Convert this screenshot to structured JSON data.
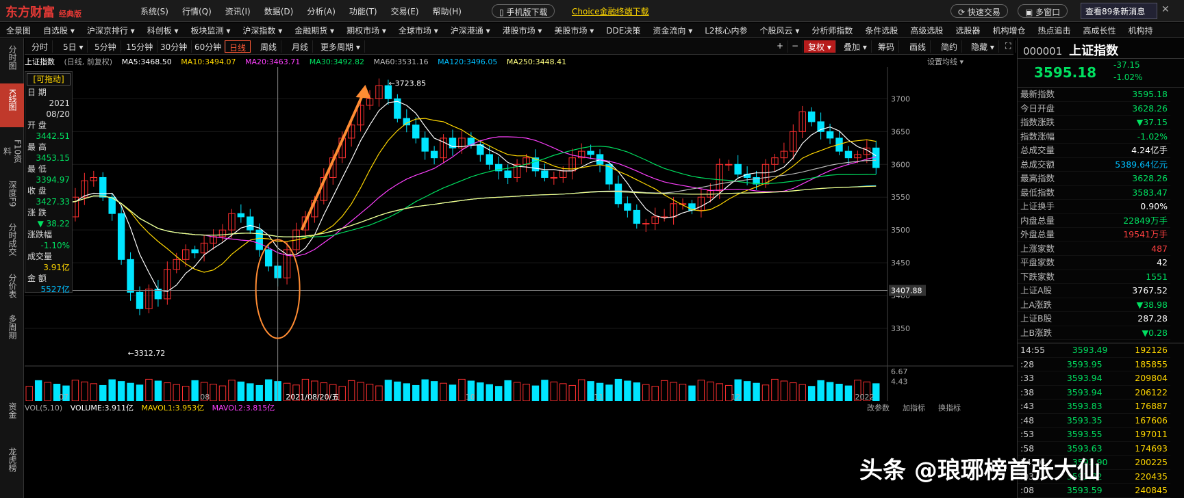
{
  "app": {
    "logo": "东方财富",
    "edition": "经典版"
  },
  "menu": [
    "系统(S)",
    "行情(Q)",
    "资讯(I)",
    "数据(D)",
    "分析(A)",
    "功能(T)",
    "交易(E)",
    "帮助(H)"
  ],
  "title_buttons": {
    "mobile": "手机版下载",
    "choice": "Choice金融终端下载",
    "quick_trade": "快速交易",
    "multi_window": "多窗口",
    "notice": "查看89条新消息"
  },
  "nav": [
    "全景图",
    "自选股 ▾",
    "沪深京排行 ▾",
    "科创板 ▾",
    "板块监测 ▾",
    "沪深指数 ▾",
    "金融期货 ▾",
    "期权市场 ▾",
    "全球市场 ▾",
    "沪深港通 ▾",
    "港股市场 ▾",
    "美股市场 ▾",
    "DDE决策",
    "资金流向 ▾",
    "L2核心内参",
    "个股风云 ▾",
    "分析师指数",
    "条件选股",
    "高级选股",
    "选股器",
    "机构增仓",
    "热点追击",
    "高成长性",
    "机构持"
  ],
  "leftside": [
    "分时图",
    "K线图",
    "F10资料",
    "深度F9",
    "分时成交",
    "分价表",
    "多周期",
    "资金",
    "龙虎榜"
  ],
  "periods": [
    "分时",
    "5日 ▾",
    "5分钟",
    "15分钟",
    "30分钟",
    "60分钟",
    "日线",
    "周线",
    "月线",
    "更多周期 ▾"
  ],
  "tools": [
    "+",
    "−",
    "复权 ▾",
    "叠加 ▾",
    "筹码",
    "画线",
    "简约",
    "隐藏 ▾"
  ],
  "chart_title": "上证指数",
  "chart_subtitle": "(日线, 前复权)",
  "setting_line": "设置均线 ▾",
  "ma_legend": [
    {
      "label": "MA5:3468.50",
      "color": "#ffffff"
    },
    {
      "label": "MA10:3494.07",
      "color": "#ffd700"
    },
    {
      "label": "MA20:3463.71",
      "color": "#ff40ff"
    },
    {
      "label": "MA30:3492.82",
      "color": "#00e060"
    },
    {
      "label": "MA60:3531.16",
      "color": "#bbbbbb"
    },
    {
      "label": "MA120:3496.05",
      "color": "#00bfff"
    },
    {
      "label": "MA250:3448.41",
      "color": "#ffff80"
    }
  ],
  "info_panel": {
    "drag": "[可拖动]",
    "date_label": "日 期",
    "year": "2021",
    "date": "08/20",
    "open_label": "开 盘",
    "open": "3442.51",
    "high_label": "最 高",
    "high": "3453.15",
    "low_label": "最 低",
    "low": "3394.97",
    "close_label": "收 盘",
    "close": "3427.33",
    "chg_label": "涨 跌",
    "chg": "▼ 38.22",
    "pct_label": "涨跌幅",
    "pct": "-1.10%",
    "vol_label": "成交量",
    "vol": "3.91亿",
    "amt_label": "金 额",
    "amt": "5527亿"
  },
  "annotations": {
    "high": "3723.85",
    "low": "3312.72",
    "cursor_price": "3407.88",
    "cursor_date": "2021/08/20/五"
  },
  "vol_legend": {
    "vol": "VOL(5,10)",
    "volume": "VOLUME:3.911亿",
    "mavol1": "MAVOL1:3.953亿",
    "mavol2": "MAVOL2:3.815亿",
    "params": "改参数",
    "add": "加指标",
    "switch": "换指标"
  },
  "right_panel": {
    "code": "000001",
    "name": "上证指数",
    "price": "3595.18",
    "chg": "-37.15",
    "pct": "-1.02%",
    "rows": [
      {
        "k": "最新指数",
        "v": "3595.18",
        "c": "#00e060"
      },
      {
        "k": "今日开盘",
        "v": "3628.26",
        "c": "#00e060"
      },
      {
        "k": "指数涨跌",
        "v": "▼37.15",
        "c": "#00e060"
      },
      {
        "k": "指数涨幅",
        "v": "-1.02%",
        "c": "#00e060"
      },
      {
        "k": "总成交量",
        "v": "4.24亿手",
        "c": "#ffffff"
      },
      {
        "k": "总成交额",
        "v": "5389.64亿元",
        "c": "#00bfff"
      },
      {
        "k": "最高指数",
        "v": "3628.26",
        "c": "#00e060"
      },
      {
        "k": "最低指数",
        "v": "3583.47",
        "c": "#00e060"
      },
      {
        "k": "上证换手",
        "v": "0.90%",
        "c": "#ffffff"
      },
      {
        "k": "内盘总量",
        "v": "22849万手",
        "c": "#00e060"
      },
      {
        "k": "外盘总量",
        "v": "19541万手",
        "c": "#ff4040"
      },
      {
        "k": "上涨家数",
        "v": "487",
        "c": "#ff4040"
      },
      {
        "k": "平盘家数",
        "v": "42",
        "c": "#ffffff"
      },
      {
        "k": "下跌家数",
        "v": "1551",
        "c": "#00e060"
      },
      {
        "k": "上证A股",
        "v": "3767.52",
        "c": "#ffffff"
      },
      {
        "k": "上A涨跌",
        "v": "▼38.98",
        "c": "#00e060"
      },
      {
        "k": "上证B股",
        "v": "287.28",
        "c": "#ffffff"
      },
      {
        "k": "上B涨跌",
        "v": "▼0.28",
        "c": "#00e060"
      }
    ],
    "ticks": [
      {
        "t": "14:55",
        "p": "3593.49",
        "v": "192126"
      },
      {
        "t": ":28",
        "p": "3593.95",
        "v": "185855"
      },
      {
        "t": ":33",
        "p": "3593.94",
        "v": "209804"
      },
      {
        "t": ":38",
        "p": "3593.94",
        "v": "206122"
      },
      {
        "t": ":43",
        "p": "3593.83",
        "v": "176887"
      },
      {
        "t": ":48",
        "p": "3593.35",
        "v": "167606"
      },
      {
        "t": ":53",
        "p": "3593.55",
        "v": "197011"
      },
      {
        "t": ":58",
        "p": "3593.63",
        "v": "174693"
      },
      {
        "t": "14:56",
        "p": "3593.90",
        "v": "200225"
      },
      {
        "t": ":03",
        "p": "3593.72",
        "v": "220435"
      },
      {
        "t": ":08",
        "p": "3593.59",
        "v": "240845"
      }
    ]
  },
  "watermark": "头条 @琅琊榜首张大仙",
  "chart_data": {
    "type": "candlestick",
    "title": "上证指数",
    "subtitle": "(日线, 前复权)",
    "ylim": [
      3300,
      3740
    ],
    "y_ticks": [
      3350,
      3400,
      3450,
      3500,
      3550,
      3600,
      3650,
      3700
    ],
    "x_labels": [
      "07",
      "08",
      "2021/08/20/五",
      "10",
      "11",
      "12",
      "2022"
    ],
    "high_annotation": 3723.85,
    "low_annotation": 3312.72,
    "close_path": [
      3545,
      3530,
      3560,
      3555,
      3520,
      3550,
      3575,
      3580,
      3550,
      3525,
      3455,
      3405,
      3380,
      3410,
      3395,
      3440,
      3455,
      3470,
      3465,
      3480,
      3490,
      3500,
      3525,
      3520,
      3500,
      3470,
      3445,
      3427,
      3470,
      3500,
      3520,
      3545,
      3580,
      3610,
      3640,
      3660,
      3690,
      3700,
      3720,
      3700,
      3670,
      3660,
      3640,
      3620,
      3610,
      3640,
      3625,
      3640,
      3630,
      3615,
      3600,
      3590,
      3580,
      3600,
      3610,
      3590,
      3580,
      3580,
      3590,
      3610,
      3620,
      3615,
      3600,
      3570,
      3540,
      3530,
      3510,
      3510,
      3520,
      3520,
      3540,
      3540,
      3530,
      3550,
      3560,
      3600,
      3600,
      3585,
      3580,
      3570,
      3600,
      3610,
      3620,
      3650,
      3680,
      3665,
      3650,
      3640,
      3620,
      3610,
      3615,
      3625,
      3595
    ],
    "volume_axis": [
      4.43,
      6.67
    ]
  }
}
